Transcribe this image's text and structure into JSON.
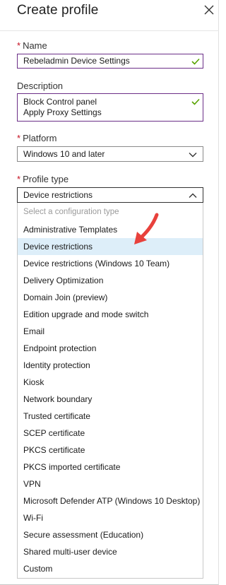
{
  "header": {
    "title": "Create profile"
  },
  "name": {
    "label": "Name",
    "value": "Rebeladmin Device Settings"
  },
  "description": {
    "label": "Description",
    "value": "Block Control panel\nApply Proxy Settings"
  },
  "platform": {
    "label": "Platform",
    "value": "Windows 10 and later"
  },
  "profile_type": {
    "label": "Profile type",
    "value": "Device restrictions",
    "placeholder": "Select a configuration type",
    "options": [
      "Administrative Templates",
      "Device restrictions",
      "Device restrictions (Windows 10 Team)",
      "Delivery Optimization",
      "Domain Join (preview)",
      "Edition upgrade and mode switch",
      "Email",
      "Endpoint protection",
      "Identity protection",
      "Kiosk",
      "Network boundary",
      "Trusted certificate",
      "SCEP certificate",
      "PKCS certificate",
      "PKCS imported certificate",
      "VPN",
      "Microsoft Defender ATP (Windows 10 Desktop)",
      "Wi-Fi",
      "Secure assessment (Education)",
      "Shared multi-user device",
      "Custom"
    ]
  },
  "colors": {
    "valid_border": "#6b2e87",
    "checkmark": "#57a300",
    "required": "#c50f1f",
    "selected_bg": "#ddeef9",
    "arrow": "#e8413c"
  },
  "icons": {
    "close": "close-icon",
    "check": "checkmark-icon",
    "chevron_down": "chevron-down-icon",
    "chevron_up": "chevron-up-icon",
    "pointer": "red-arrow-icon"
  }
}
